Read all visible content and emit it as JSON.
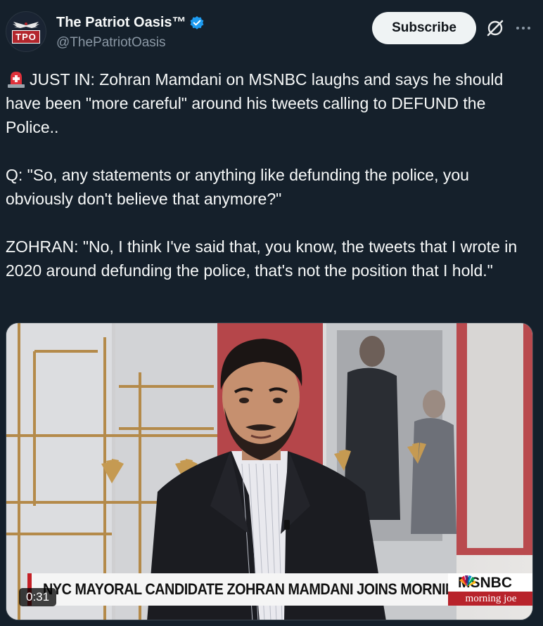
{
  "author": {
    "display_name": "The Patriot Oasis™",
    "handle": "@ThePatriotOasis",
    "avatar_text": "TPO",
    "verified": true
  },
  "actions": {
    "subscribe_label": "Subscribe",
    "grok_icon": "grok-icon",
    "more_icon": "more-icon"
  },
  "tweet": {
    "line1": "JUST IN: Zohran Mamdani on MSNBC laughs and says he should have been \"more careful\" around his tweets calling to DEFUND the Police..",
    "line2": "Q: \"So, any statements or anything like defunding the police, you obviously don't believe that anymore?\"",
    "line3": "ZOHRAN: \"No, I think I've said that, you know, the tweets that I wrote in 2020 around defunding the police, that's not the position that I hold.\""
  },
  "media": {
    "chyron": "NYC MAYORAL CANDIDATE ZOHRAN MAMDANI JOINS MORNING JOE",
    "network": "MSNBC",
    "show": "morning joe",
    "duration": "0:31"
  },
  "colors": {
    "background": "#15202b",
    "text": "#f7f9f9",
    "muted": "#8b98a5",
    "verified": "#1d9bf0",
    "chyron_red": "#c42026"
  }
}
